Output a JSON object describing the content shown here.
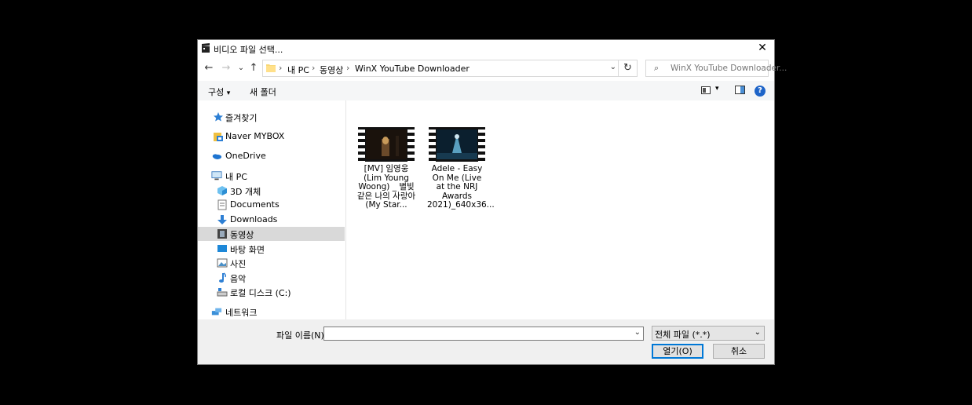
{
  "window": {
    "title": "비디오 파일 선택...",
    "close_label": "✕"
  },
  "nav": {
    "back_icon": "←",
    "forward_icon": "→",
    "recent_icon": "⌄",
    "up_icon": "↑"
  },
  "address": {
    "crumbs": [
      "내 PC",
      "동영상",
      "WinX YouTube Downloader"
    ],
    "separator": "›",
    "dropdown": "⌄",
    "refresh": "↻"
  },
  "search": {
    "placeholder": "WinX YouTube Downloader...",
    "icon": "⌕"
  },
  "toolbar": {
    "organize": "구성",
    "organize_caret": "▾",
    "new_folder": "새 폴더",
    "help": "?"
  },
  "sidebar": {
    "items": [
      {
        "label": "즐겨찾기",
        "icon": "star-icon"
      },
      {
        "label": "Naver MYBOX",
        "icon": "cloud-drive-icon"
      },
      {
        "label": "OneDrive",
        "icon": "onedrive-cloud-icon"
      },
      {
        "label": "내 PC",
        "icon": "computer-icon"
      },
      {
        "label": "3D 개체",
        "icon": "cube-3d-icon"
      },
      {
        "label": "Documents",
        "icon": "document-icon"
      },
      {
        "label": "Downloads",
        "icon": "download-arrow-icon"
      },
      {
        "label": "동영상",
        "icon": "video-folder-icon",
        "selected": true
      },
      {
        "label": "바탕 화면",
        "icon": "desktop-icon"
      },
      {
        "label": "사진",
        "icon": "pictures-icon"
      },
      {
        "label": "음악",
        "icon": "music-note-icon"
      },
      {
        "label": "로컬 디스크 (C:)",
        "icon": "disk-drive-icon"
      },
      {
        "label": "네트워크",
        "icon": "network-icon"
      }
    ]
  },
  "files": [
    {
      "label": "[MV] 임영웅(Lim Young Woong) _ 별빛 같은 나의 사랑아(My Star..."
    },
    {
      "label": "Adele - Easy On Me (Live at the NRJ Awards 2021)_640x36..."
    }
  ],
  "footer": {
    "filename_label": "파일 이름(N):",
    "filename_value": "",
    "filter_value": "전체 파일 (*.*)",
    "open_label": "열기(O)",
    "cancel_label": "취소"
  },
  "colors": {
    "accent": "#0078d7",
    "selection": "#d9d9d9",
    "help": "#1e64c8"
  }
}
